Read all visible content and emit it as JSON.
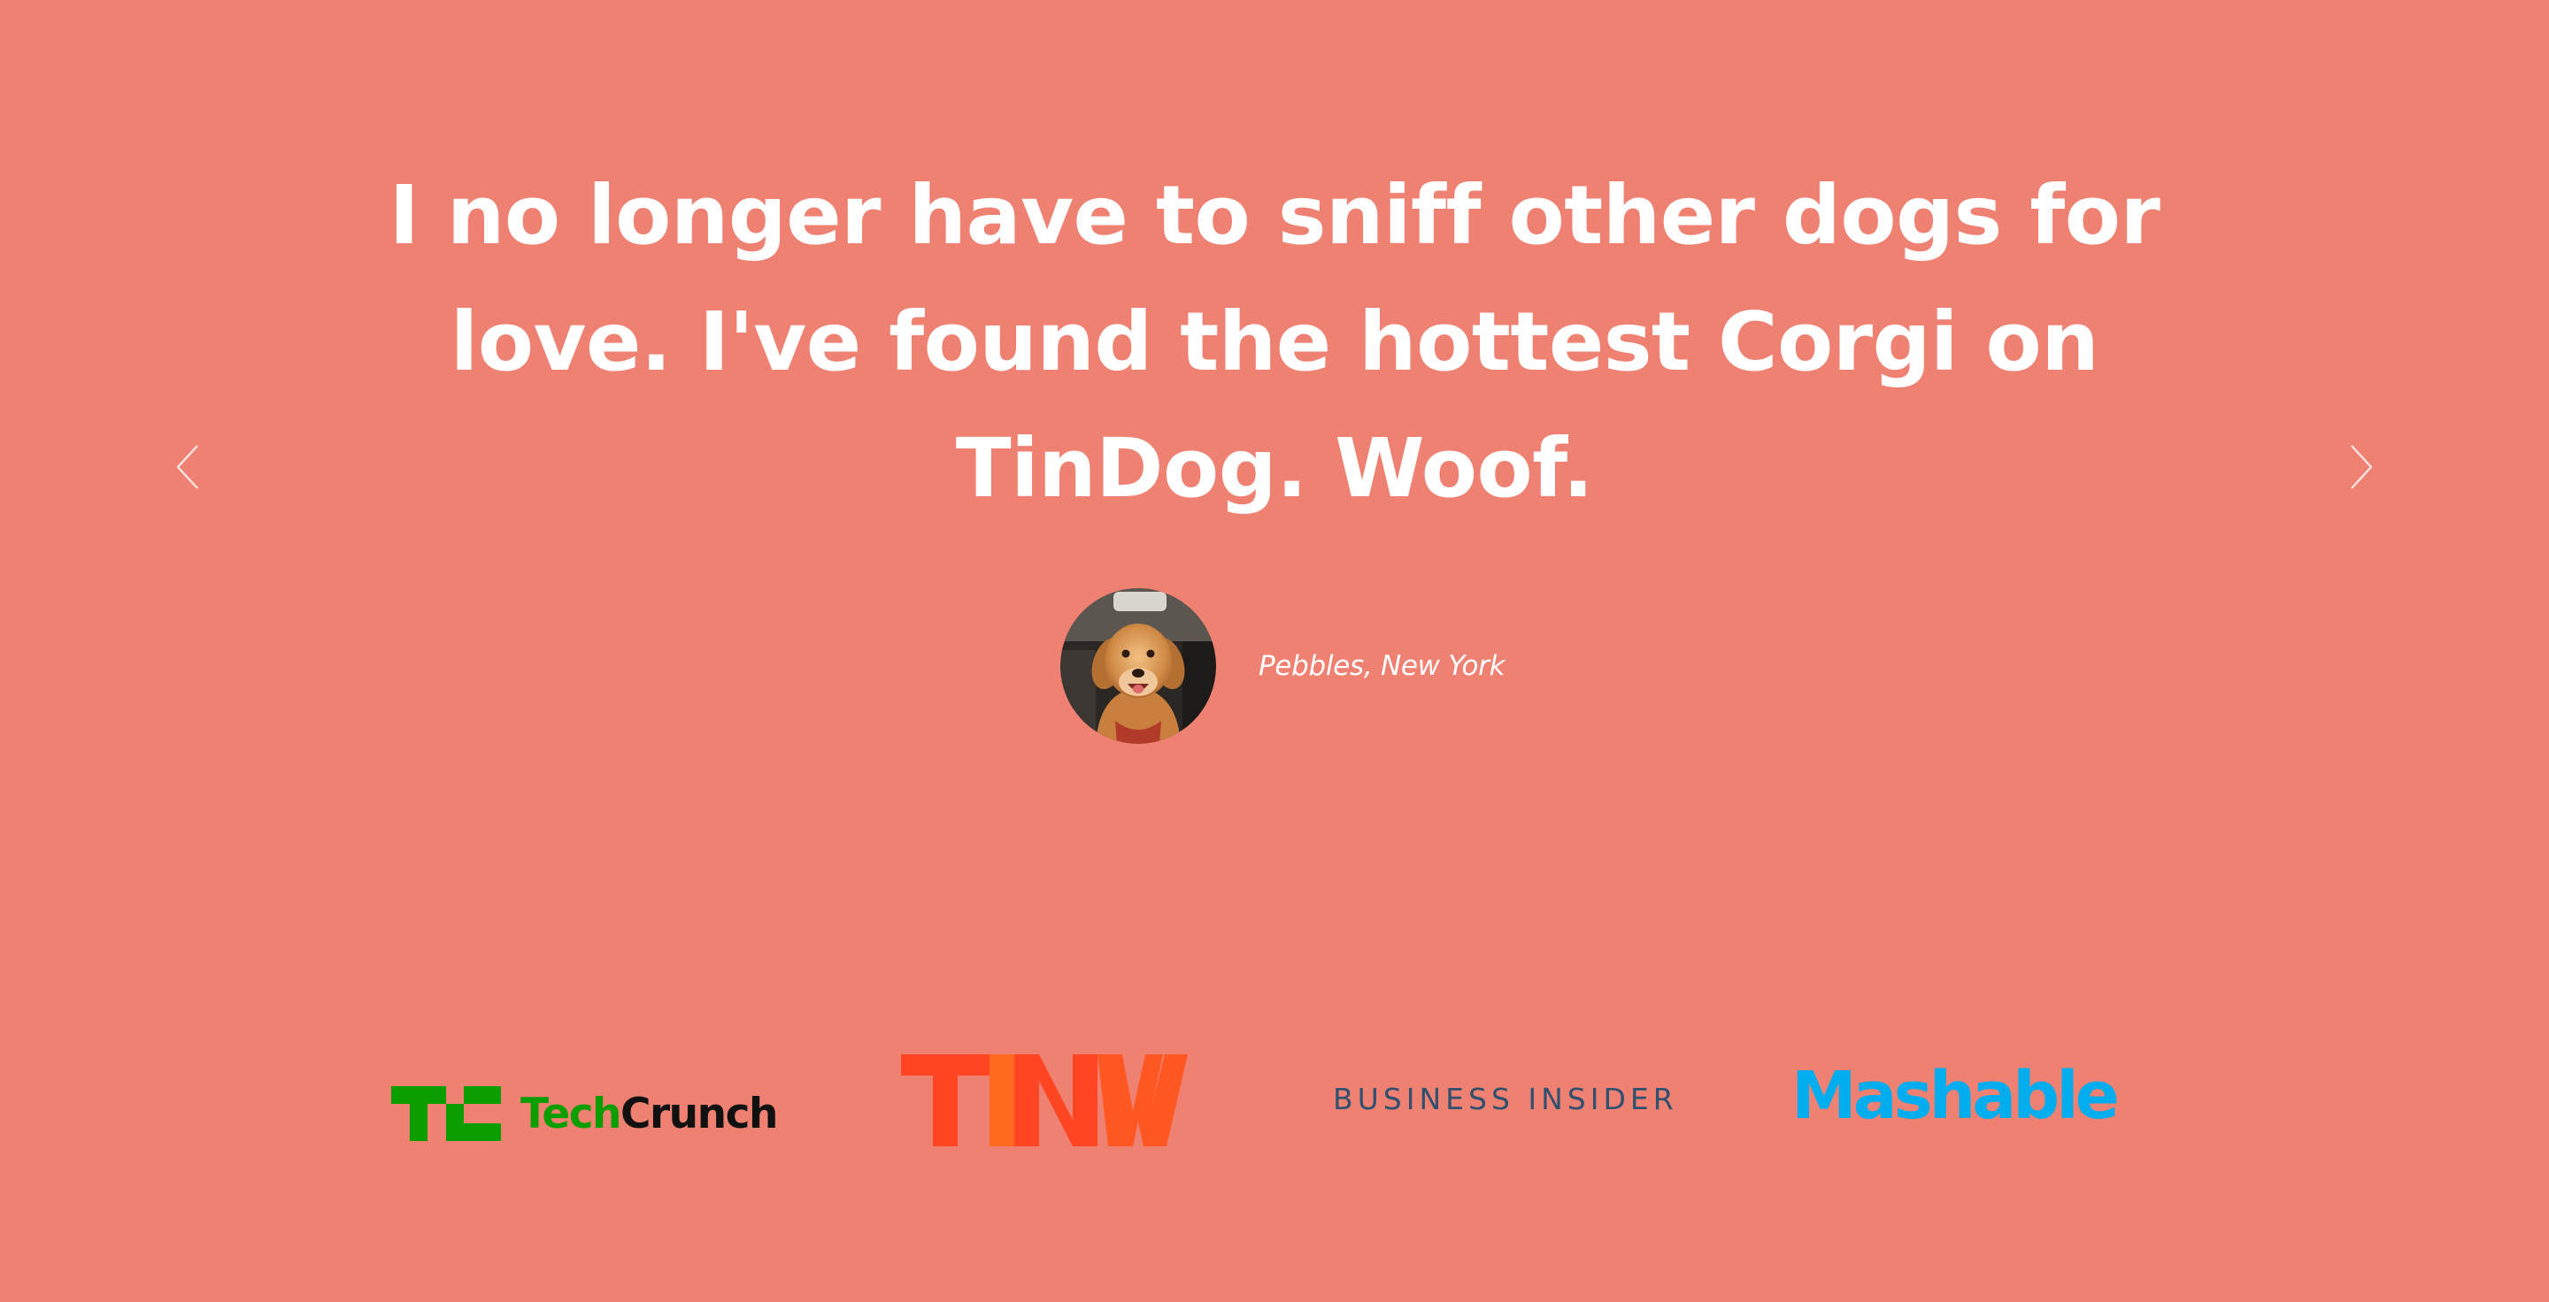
{
  "testimonial": {
    "quote": "I no longer have to sniff other dogs for love. I've found the hottest Corgi on TinDog. Woof.",
    "author": "Pebbles, New York"
  },
  "carousel": {
    "prev_icon": "chevron-left-icon",
    "next_icon": "chevron-right-icon"
  },
  "press": {
    "logos": [
      {
        "name": "TechCrunch",
        "part1": "Tech",
        "part2": "Crunch",
        "color": "#0A9E01"
      },
      {
        "name": "TNW",
        "color": "#FF4521"
      },
      {
        "name": "BUSINESS INSIDER",
        "color": "#30506F"
      },
      {
        "name": "Mashable",
        "color": "#00AEEF"
      }
    ]
  },
  "colors": {
    "background": "#EF8172",
    "text": "#FFFFFF"
  }
}
